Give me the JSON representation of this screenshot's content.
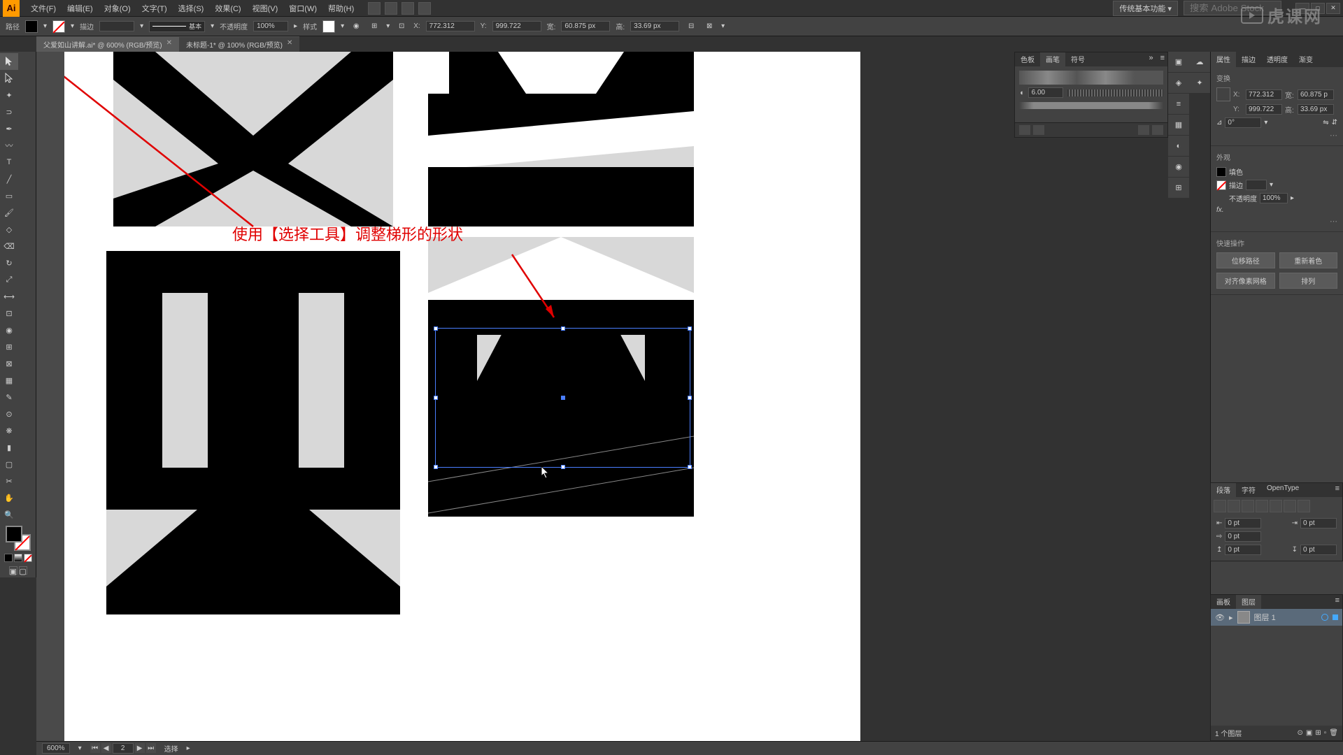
{
  "app": {
    "name": "Ai"
  },
  "menu": {
    "file": "文件(F)",
    "edit": "编辑(E)",
    "object": "对象(O)",
    "text": "文字(T)",
    "select": "选择(S)",
    "effect": "效果(C)",
    "view": "视图(V)",
    "window": "窗口(W)",
    "help": "帮助(H)"
  },
  "workspace": "传统基本功能",
  "search_placeholder": "搜索 Adobe Stock",
  "controlbar": {
    "mode": "路径",
    "stroke_label": "描边",
    "stroke_val": "",
    "stroke_style": "基本",
    "opacity_label": "不透明度",
    "opacity_val": "100%",
    "style_label": "样式",
    "x_label": "X:",
    "x_val": "772.312",
    "y_label": "Y:",
    "y_val": "999.722",
    "w_label": "宽:",
    "w_val": "60.875 px",
    "h_label": "高:",
    "h_val": "33.69 px"
  },
  "tabs": [
    {
      "title": "父爱如山讲解.ai* @ 600% (RGB/预览)",
      "active": true
    },
    {
      "title": "未标题-1* @ 100% (RGB/预览)",
      "active": false
    }
  ],
  "annotation": "使用【选择工具】调整梯形的形状",
  "float_panel": {
    "tabs": [
      "色板",
      "画笔",
      "符号"
    ],
    "active": 1,
    "brush_size": "6.00"
  },
  "props": {
    "tabs": [
      "属性",
      "描边",
      "透明度",
      "渐变"
    ],
    "active": 0,
    "sec_transform": "变换",
    "x": "772.312",
    "y": "999.722",
    "w": "60.875 p",
    "h": "33.69 px",
    "angle": "0°",
    "sec_appearance": "外观",
    "fill_label": "填色",
    "stroke_label": "描边",
    "opacity_label": "不透明度",
    "opacity": "100%",
    "fx": "fx.",
    "sec_quick": "快速操作",
    "btn_offset": "位移路径",
    "btn_recolor": "重新着色",
    "btn_pixel": "对齐像素网格",
    "btn_arrange": "排列"
  },
  "paragraph": {
    "tabs": [
      "段落",
      "字符",
      "OpenType"
    ],
    "active": 0,
    "v1": "0 pt",
    "v2": "0 pt",
    "v3": "0 pt",
    "v4": "0 pt",
    "v5": "0 pt"
  },
  "layers": {
    "tabs": [
      "画板",
      "图层"
    ],
    "active": 1,
    "layer_name": "图层 1",
    "count": "1 个图层"
  },
  "status": {
    "zoom": "600%",
    "artboard": "2",
    "tool": "选择"
  }
}
